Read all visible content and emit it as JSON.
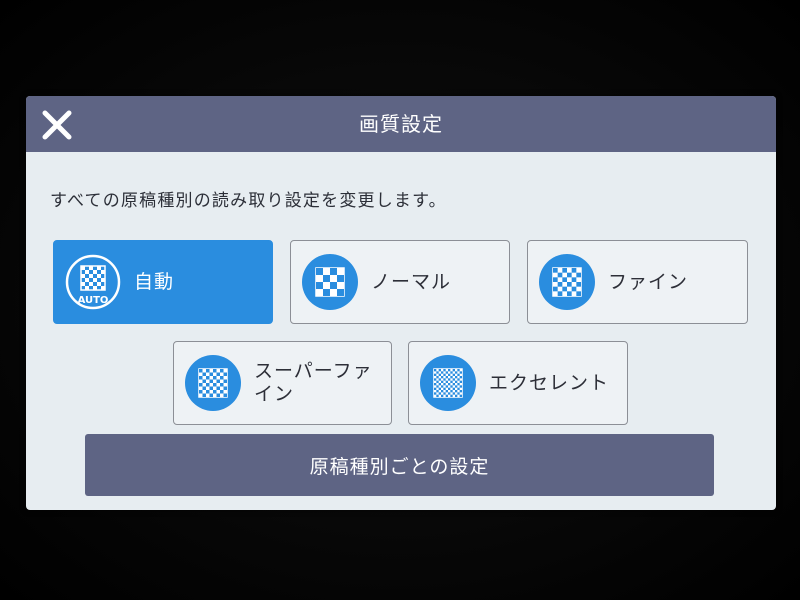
{
  "dialog": {
    "title": "画質設定",
    "close_icon": "close-icon",
    "description": "すべての原稿種別の読み取り設定を変更します。"
  },
  "options": [
    {
      "label": "自動",
      "icon": "auto-checker-icon",
      "badge": "AUTO",
      "selected": true
    },
    {
      "label": "ノーマル",
      "icon": "coarse-checker-icon",
      "selected": false
    },
    {
      "label": "ファイン",
      "icon": "fine-checker-icon",
      "selected": false
    },
    {
      "label": "スーパーファイン",
      "icon": "superfine-checker-icon",
      "selected": false
    },
    {
      "label": "エクセレント",
      "icon": "excellent-checker-icon",
      "selected": false
    }
  ],
  "footer": {
    "per_document_button": "原稿種別ごとの設定"
  },
  "colors": {
    "titlebar": "#5e6484",
    "dialog_bg": "#e7edf1",
    "accent": "#2a8ddf",
    "text": "#2c2f38"
  }
}
